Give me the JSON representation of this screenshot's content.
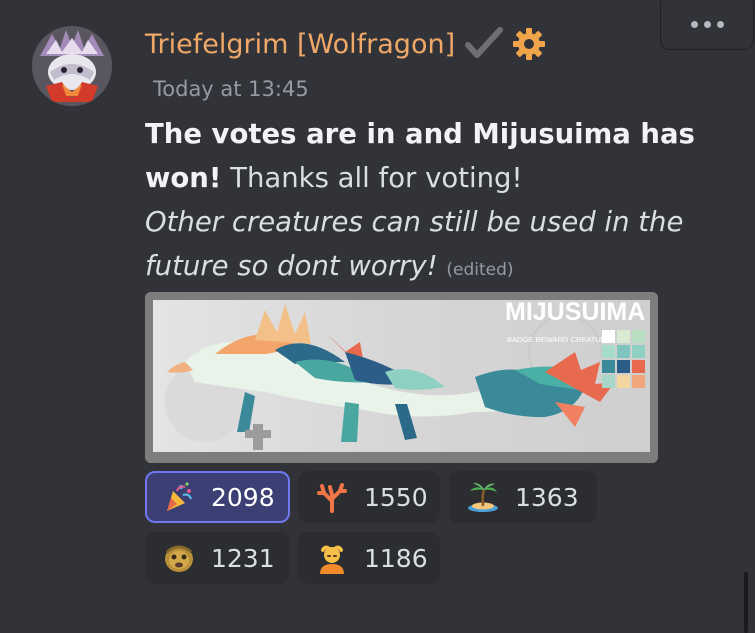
{
  "message": {
    "author": "Triefelgrim [Wolfragon]",
    "timestamp": "Today at 13:45",
    "text_bold": "The votes are in and Mijusuima has won!",
    "text_plain": " Thanks all for voting!",
    "text_italic": "Other creatures can still be used in the future so dont worry!",
    "edited_label": "(edited)"
  },
  "attachment": {
    "title": "MIJUSUIMA",
    "subtitle": "BADGE REWARD CREATURE",
    "palette": [
      "#ffffff",
      "#d9ebd2",
      "#b9dfc2",
      "#a7dcc8",
      "#7fc4bf",
      "#8ed0c1",
      "#3a8a99",
      "#2b5d88",
      "#e86a4e",
      "#a7d5c7",
      "#f4d6a0",
      "#f0a57a"
    ]
  },
  "reactions": [
    {
      "emoji": "party-popper-icon",
      "count": "2098",
      "selected": true
    },
    {
      "emoji": "coral-icon",
      "count": "1550",
      "selected": false
    },
    {
      "emoji": "desert-island-icon",
      "count": "1363",
      "selected": false
    },
    {
      "emoji": "face-icon",
      "count": "1231",
      "selected": false
    },
    {
      "emoji": "person-icon",
      "count": "1186",
      "selected": false
    }
  ],
  "colors": {
    "background": "#313338",
    "username": "#f0a868",
    "reaction_selected_border": "#6f78f0"
  }
}
